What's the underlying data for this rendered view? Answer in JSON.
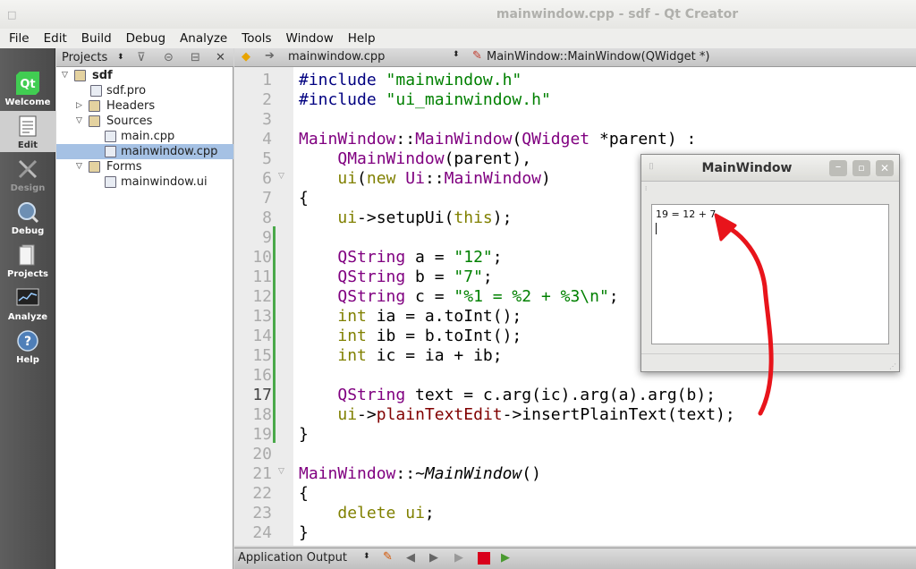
{
  "window": {
    "title": "mainwindow.cpp - sdf - Qt Creator",
    "control": "□"
  },
  "menu": [
    "File",
    "Edit",
    "Build",
    "Debug",
    "Analyze",
    "Tools",
    "Window",
    "Help"
  ],
  "modes": [
    {
      "label": "Welcome",
      "icon": "qt-logo-icon"
    },
    {
      "label": "Edit",
      "icon": "edit-document-icon"
    },
    {
      "label": "Design",
      "icon": "design-tools-icon"
    },
    {
      "label": "Debug",
      "icon": "debug-bug-icon"
    },
    {
      "label": "Projects",
      "icon": "projects-folder-icon"
    },
    {
      "label": "Analyze",
      "icon": "analyze-monitor-icon"
    },
    {
      "label": "Help",
      "icon": "help-question-icon"
    }
  ],
  "projects": {
    "selector": "Projects",
    "tree": [
      {
        "label": "sdf",
        "depth": 0,
        "expanded": true,
        "icon": "project-folder-icon"
      },
      {
        "label": "sdf.pro",
        "depth": 1,
        "icon": "pro-file-icon"
      },
      {
        "label": "Headers",
        "depth": 1,
        "expanded": false,
        "icon": "headers-folder-icon"
      },
      {
        "label": "Sources",
        "depth": 1,
        "expanded": true,
        "icon": "sources-folder-icon"
      },
      {
        "label": "main.cpp",
        "depth": 2,
        "icon": "cpp-file-icon"
      },
      {
        "label": "mainwindow.cpp",
        "depth": 2,
        "icon": "cpp-file-icon",
        "selected": true
      },
      {
        "label": "Forms",
        "depth": 1,
        "expanded": true,
        "icon": "forms-folder-icon"
      },
      {
        "label": "mainwindow.ui",
        "depth": 2,
        "icon": "ui-file-icon"
      }
    ]
  },
  "editor": {
    "file": "mainwindow.cpp",
    "symbol": "MainWindow::MainWindow(QWidget *)",
    "current_line": 17,
    "lines": [
      "#include \"mainwindow.h\"",
      "#include \"ui_mainwindow.h\"",
      "",
      "MainWindow::MainWindow(QWidget *parent) :",
      "    QMainWindow(parent),",
      "    ui(new Ui::MainWindow)",
      "{",
      "    ui->setupUi(this);",
      "",
      "    QString a = \"12\";",
      "    QString b = \"7\";",
      "    QString c = \"%1 = %2 + %3\\n\";",
      "    int ia = a.toInt();",
      "    int ib = b.toInt();",
      "    int ic = ia + ib;",
      "",
      "    QString text = c.arg(ic).arg(a).arg(b);",
      "    ui->plainTextEdit->insertPlainText(text);",
      "}",
      "",
      "MainWindow::~MainWindow()",
      "{",
      "    delete ui;",
      "}"
    ],
    "line_numbers": [
      "1",
      "2",
      "3",
      "4",
      "5",
      "6",
      "7",
      "8",
      "9",
      "10",
      "11",
      "12",
      "13",
      "14",
      "15",
      "16",
      "17",
      "18",
      "19",
      "20",
      "21",
      "22",
      "23",
      "24"
    ]
  },
  "output_pane": {
    "label": "Application Output"
  },
  "app_window": {
    "title": "MainWindow",
    "text_output": "19 = 12 + 7"
  },
  "colors": {
    "selection": "#a5c1e4",
    "arrow": "#e8141b",
    "string": "#008000",
    "class": "#800080",
    "keyword": "#808000"
  }
}
